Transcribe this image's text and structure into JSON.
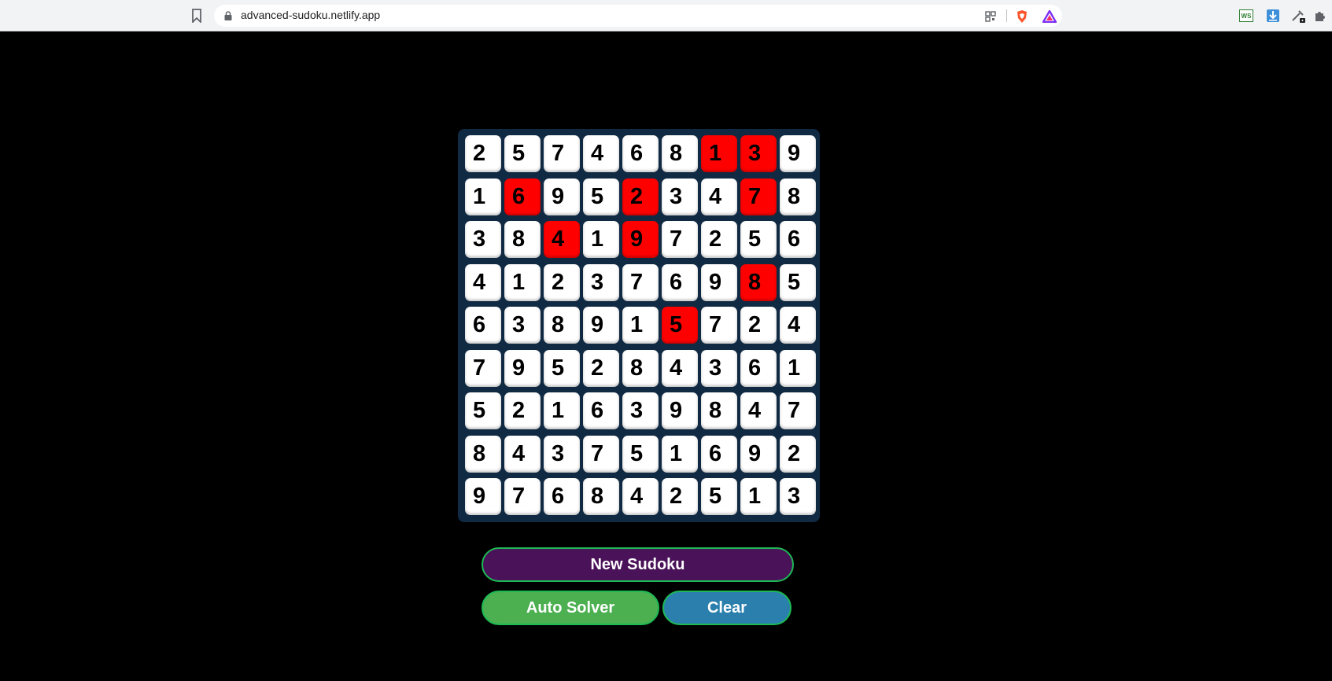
{
  "browser": {
    "url": "advanced-sudoku.netlify.app",
    "icons": [
      "bookmark-icon",
      "lock-icon",
      "qr-code-icon",
      "brave-shield-icon",
      "brave-rewards-icon",
      "ws-extension-icon",
      "download-icon",
      "eyedropper-icon",
      "extensions-puzzle-icon"
    ]
  },
  "sudoku": {
    "grid": [
      [
        "2",
        "5",
        "7",
        "4",
        "6",
        "8",
        "1",
        "3",
        "9"
      ],
      [
        "1",
        "6",
        "9",
        "5",
        "2",
        "3",
        "4",
        "7",
        "8"
      ],
      [
        "3",
        "8",
        "4",
        "1",
        "9",
        "7",
        "2",
        "5",
        "6"
      ],
      [
        "4",
        "1",
        "2",
        "3",
        "7",
        "6",
        "9",
        "8",
        "5"
      ],
      [
        "6",
        "3",
        "8",
        "9",
        "1",
        "5",
        "7",
        "2",
        "4"
      ],
      [
        "7",
        "9",
        "5",
        "2",
        "8",
        "4",
        "3",
        "6",
        "1"
      ],
      [
        "5",
        "2",
        "1",
        "6",
        "3",
        "9",
        "8",
        "4",
        "7"
      ],
      [
        "8",
        "4",
        "3",
        "7",
        "5",
        "1",
        "6",
        "9",
        "2"
      ],
      [
        "9",
        "7",
        "6",
        "8",
        "4",
        "2",
        "5",
        "1",
        "3"
      ]
    ],
    "highlighted": [
      [
        0,
        6
      ],
      [
        0,
        7
      ],
      [
        1,
        1
      ],
      [
        1,
        4
      ],
      [
        1,
        7
      ],
      [
        2,
        2
      ],
      [
        2,
        4
      ],
      [
        3,
        7
      ],
      [
        4,
        5
      ]
    ],
    "highlight_color": "#ff0000"
  },
  "buttons": {
    "new_sudoku": "New Sudoku",
    "auto_solver": "Auto Solver",
    "clear": "Clear"
  },
  "colors": {
    "background": "#000000",
    "board": "#102a43",
    "new_sudoku": "#4a1259",
    "auto_solver": "#4caf50",
    "clear": "#2a7fad",
    "button_border": "#1db954"
  }
}
